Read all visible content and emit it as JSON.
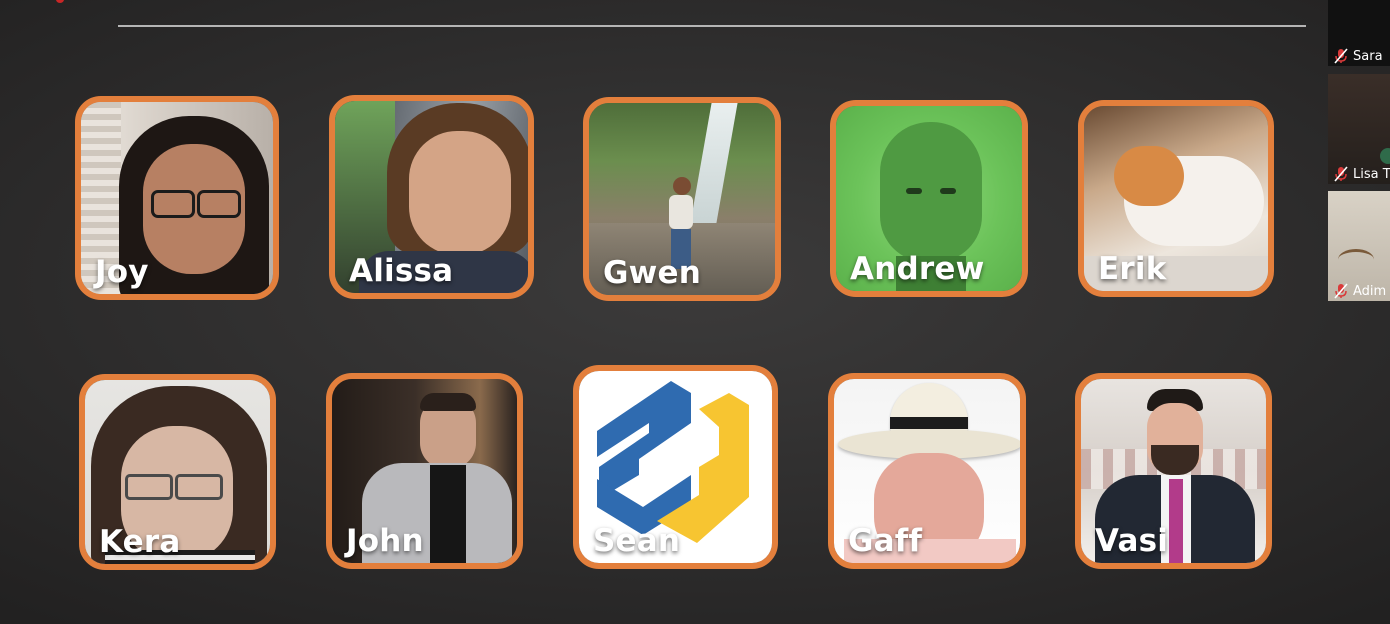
{
  "participants": [
    {
      "name": "Joy"
    },
    {
      "name": "Alissa"
    },
    {
      "name": "Gwen"
    },
    {
      "name": "Andrew"
    },
    {
      "name": "Erik"
    },
    {
      "name": "Kera"
    },
    {
      "name": "John"
    },
    {
      "name": "Sean"
    },
    {
      "name": "Gaff"
    },
    {
      "name": "Vasi"
    }
  ],
  "side_panel": [
    {
      "label": "Sara",
      "mic": "mic-muted-icon"
    },
    {
      "label": "Lisa T",
      "mic": "mic-muted-icon"
    },
    {
      "label": "Adim",
      "mic": "mic-muted-icon"
    }
  ],
  "colors": {
    "tile_border": "#e37f3c",
    "background": "#2e2d2d",
    "mute_red": "#d93a3a",
    "logo_blue": "#2f6bb0",
    "logo_yellow": "#f7c531"
  }
}
